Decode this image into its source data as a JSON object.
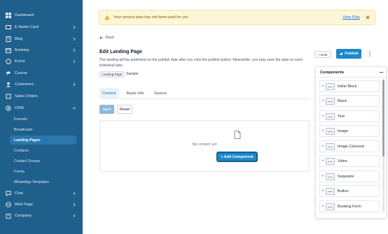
{
  "sidebar": {
    "items": [
      {
        "label": "Dashboard",
        "icon": "dashboard-icon",
        "chevron": false
      },
      {
        "label": "E-Name Card",
        "icon": "card-icon",
        "chevron": true
      },
      {
        "label": "Blog",
        "icon": "blog-icon",
        "chevron": true
      },
      {
        "label": "Booking",
        "icon": "calendar-icon",
        "chevron": true
      },
      {
        "label": "Event",
        "icon": "event-icon",
        "chevron": true
      },
      {
        "label": "Course",
        "icon": "course-icon",
        "chevron": false
      },
      {
        "label": "Customers",
        "icon": "users-icon",
        "chevron": true
      },
      {
        "label": "Sales Orders",
        "icon": "orders-icon",
        "chevron": false
      },
      {
        "label": "CRM",
        "icon": "crm-icon",
        "chevron": true
      }
    ],
    "crm_sub": [
      "Funnels",
      "Broadcasts",
      "Landing Pages",
      "Contacts",
      "Contact Groups",
      "Forms",
      "WhatsApp Templates"
    ],
    "bottom_items": [
      {
        "label": "Chat",
        "icon": "chat-icon"
      },
      {
        "label": "Web Page",
        "icon": "web-icon"
      },
      {
        "label": "Company",
        "icon": "company-icon"
      }
    ]
  },
  "banner": {
    "message": "Your service plan has not been paid for yet.",
    "link": "View Plan"
  },
  "page": {
    "back": "Back",
    "title": "Edit Landing Page",
    "description": "The landing will be published on the publish date after you click the publish button. Meanwhile, you may save the data on each individual tabs.",
    "tag": "Landing Page",
    "name": "Sample",
    "status": "• Draft",
    "publish": "Publish"
  },
  "tabs": [
    "Content",
    "Basic Info",
    "Source"
  ],
  "actions": {
    "save": "Save",
    "reset": "Reset"
  },
  "canvas": {
    "empty": "No content yet",
    "add": "+ Add Component"
  },
  "components_panel": {
    "title": "Components",
    "items": [
      "Inline Block",
      "Block",
      "Text",
      "Image",
      "Image Carousel",
      "Video",
      "Separator",
      "Button",
      "Booking Form"
    ]
  },
  "colors": {
    "sidebar": "#1f5f8b",
    "accent": "#1e88c9",
    "banner": "#fdf6d8"
  }
}
